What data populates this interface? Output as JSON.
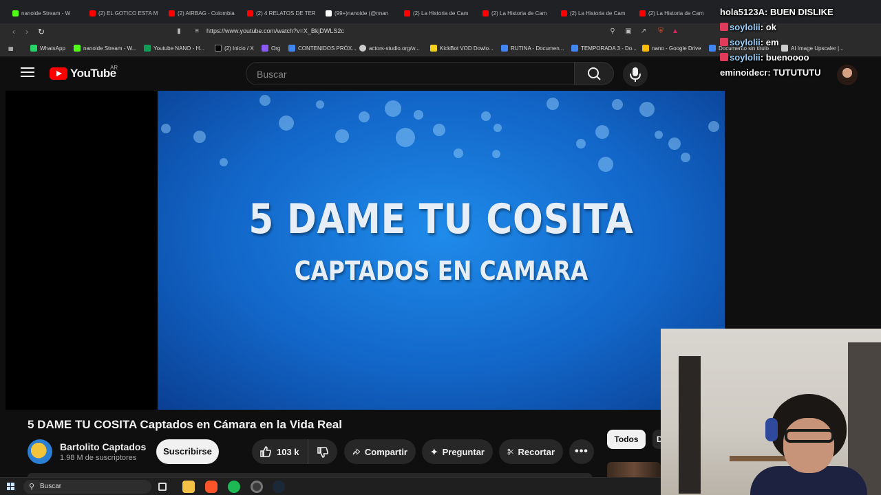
{
  "browser": {
    "tabs": [
      {
        "label": "nanoide Stream - W",
        "favicon": "kick-icon"
      },
      {
        "label": "(2) EL GOTICO ESTA MI",
        "favicon": "youtube-icon"
      },
      {
        "label": "(2) AIRBAG - Colombia",
        "favicon": "youtube-icon"
      },
      {
        "label": "(2) 4 RELATOS DE TERR",
        "favicon": "youtube-icon"
      },
      {
        "label": "(99+)nanoide (@nnan",
        "favicon": "tiktok-icon"
      },
      {
        "label": "(2) La Historia de Cam",
        "favicon": "youtube-icon"
      },
      {
        "label": "(2) La Historia de Cam",
        "favicon": "youtube-icon"
      },
      {
        "label": "(2) La Historia de Cam",
        "favicon": "youtube-icon"
      },
      {
        "label": "(2) La Historia de Cam",
        "favicon": "youtube-icon"
      }
    ],
    "url": "https://www.youtube.com/watch?v=X_BkjDWLS2c",
    "bookmarks": [
      {
        "label": "WhatsApp",
        "color": "#25d366"
      },
      {
        "label": "nanoide Stream - W...",
        "color": "#53fc18"
      },
      {
        "label": "Youtube NANO - H...",
        "color": "#0f9d58"
      },
      {
        "label": "(2) Inicio / X",
        "color": "#000000"
      },
      {
        "label": "Org",
        "color": "#8a5cf5"
      },
      {
        "label": "CONTENIDOS PRÓX...",
        "color": "#4285f4"
      },
      {
        "label": "actors-studio.org/w...",
        "color": "#cccccc"
      },
      {
        "label": "KickBot VOD Dowlo...",
        "color": "#f4d21b"
      },
      {
        "label": "RUTINA - Documen...",
        "color": "#4285f4"
      },
      {
        "label": "TEMPORADA 3 - Do...",
        "color": "#4285f4"
      },
      {
        "label": "nano - Google Drive",
        "color": "#fbbc04"
      },
      {
        "label": "Documento sin título",
        "color": "#4285f4"
      },
      {
        "label": "AI Image Upscaler |...",
        "color": "#cccccc"
      }
    ]
  },
  "youtube": {
    "logo_text": "YouTube",
    "country_code": "AR",
    "search_placeholder": "Buscar",
    "video": {
      "title_line1": "5 DAME TU COSITA",
      "title_line2": "CAPTADOS EN CAMARA"
    },
    "video_title": "5 DAME TU COSITA Captados en Cámara en la Vida Real",
    "channel": {
      "name": "Bartolito Captados",
      "subscribers": "1.98 M de suscriptores"
    },
    "subscribe_label": "Suscribirse",
    "like_count": "103 k",
    "share_label": "Compartir",
    "ask_label": "Preguntar",
    "clip_label": "Recortar",
    "more_label": "•••",
    "chips": [
      "Todos",
      "D"
    ]
  },
  "chat": [
    {
      "user": "hola5123A",
      "message": "BUEN DISLIKE",
      "badge": false,
      "user_color": "#f2f2f2"
    },
    {
      "user": "soylolii",
      "message": "ok",
      "badge": true,
      "user_color": "#9ad1ff"
    },
    {
      "user": "soylolii",
      "message": "em",
      "badge": true,
      "user_color": "#9ad1ff"
    },
    {
      "user": "soylolii",
      "message": "buenoooo",
      "badge": true,
      "user_color": "#9ad1ff"
    },
    {
      "user": "eminoidecr",
      "message": "TUTUTUTU",
      "badge": false,
      "user_color": "#f2f2f2"
    }
  ],
  "taskbar": {
    "search_label": "Buscar",
    "apps": [
      "task-view-icon",
      "file-explorer-icon",
      "brave-icon",
      "spotify-icon",
      "obs-icon",
      "steam-icon"
    ]
  },
  "colors": {
    "youtube_red": "#ff0000",
    "video_blue": "#1572d6",
    "kick_green": "#53fc18"
  }
}
